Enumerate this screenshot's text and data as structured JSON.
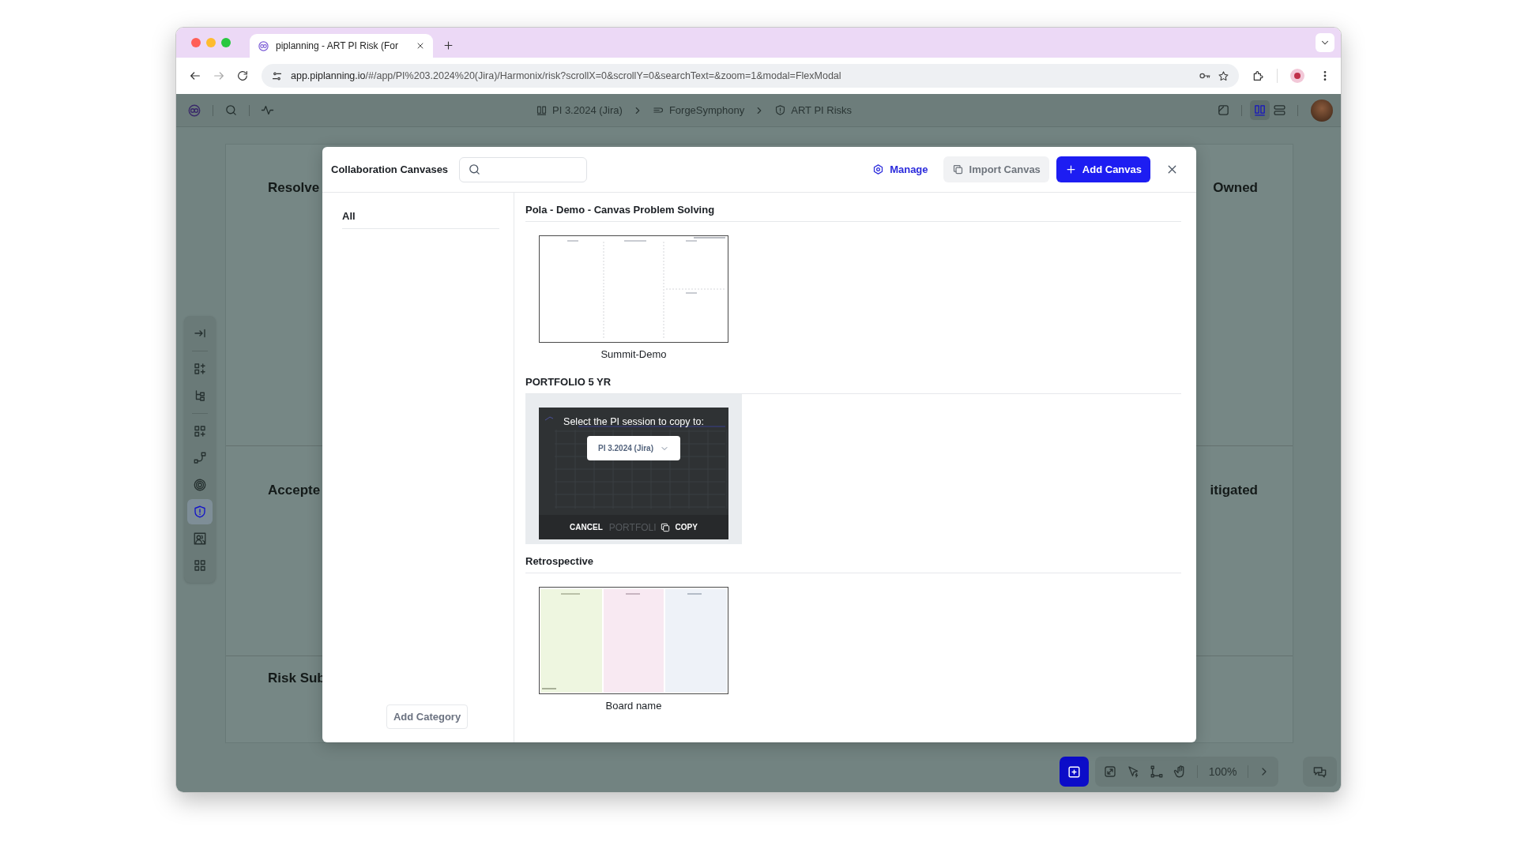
{
  "browser": {
    "tabs": [
      {
        "title": "piplanning - ART PI Risk (For",
        "selected": true
      }
    ],
    "url_host": "app.piplanning.io",
    "url_path": "/#/app/PI%203.2024%20(Jira)/Harmonix/risk?scrollX=0&scrollY=0&searchText=&zoom=1&modal=FlexModal"
  },
  "app_bar": {
    "breadcrumb": [
      {
        "label": "PI 3.2024 (Jira)",
        "kind": "board"
      },
      {
        "label": "ForgeSymphony",
        "kind": "team"
      },
      {
        "label": "ART PI Risks",
        "kind": "risk"
      }
    ],
    "views": [
      {
        "kind": "columns",
        "selected": true
      },
      {
        "kind": "rows",
        "selected": false
      }
    ]
  },
  "board": {
    "rows": [
      {
        "left": "Resolve",
        "right": "Owned"
      },
      {
        "left": "Accepte",
        "right": "itigated"
      },
      {
        "left": "Risk Sub"
      }
    ]
  },
  "tool_groups": [
    {
      "tools": [
        {
          "kind": "collapse",
          "selected": false
        }
      ]
    },
    {
      "tools": [
        {
          "kind": "add-items",
          "selected": false
        },
        {
          "kind": "hierarchy",
          "selected": false
        }
      ]
    },
    {
      "tools": [
        {
          "kind": "add-board",
          "selected": false
        },
        {
          "kind": "connector",
          "selected": false
        },
        {
          "kind": "target",
          "selected": false
        },
        {
          "kind": "risk",
          "selected": true
        },
        {
          "kind": "people",
          "selected": false
        },
        {
          "kind": "apps",
          "selected": false
        }
      ]
    }
  ],
  "bottom_bar": {
    "zoom": "100%"
  },
  "modal": {
    "title": "Collaboration Canvases",
    "actions": [
      {
        "label": "Manage",
        "kind": "link"
      },
      {
        "label": "Import Canvas",
        "kind": "secondary"
      },
      {
        "label": "Add Canvas",
        "kind": "primary"
      }
    ],
    "categories": [
      {
        "label": "All",
        "selected": true
      }
    ],
    "add_category": "Add Category",
    "sections": [
      {
        "title": "Pola - Demo - Canvas Problem Solving",
        "canvases": [
          {
            "name": "Summit-Demo",
            "kind": "problem-solving",
            "hovered": false
          }
        ]
      },
      {
        "title": "PORTFOLIO 5 YR",
        "canvases": [
          {
            "name": "PORTFOLI",
            "kind": "portfolio",
            "hovered": true,
            "copy_prompt": {
              "text": "Select the PI session to copy to:",
              "session": "PI 3.2024 (Jira)",
              "cancel": "CANCEL",
              "copy": "COPY"
            }
          }
        ]
      },
      {
        "title": "Retrospective",
        "canvases": [
          {
            "name": "Board name",
            "kind": "retrospective",
            "hovered": false
          }
        ]
      }
    ]
  }
}
